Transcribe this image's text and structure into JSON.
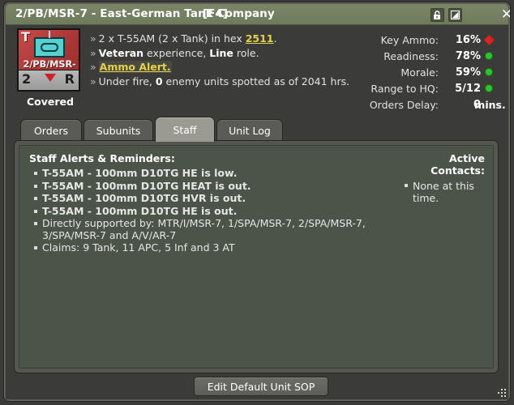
{
  "window": {
    "title": "2/PB/MSR-7 - East-German Tank Company",
    "hotkey": "[F4]",
    "buttons": {
      "lock": "lock-icon",
      "resize": "resize-icon",
      "close": "✕"
    }
  },
  "counter": {
    "type_letter": "T",
    "unit_id": "2/PB/MSR-",
    "left_digit": "2",
    "right_letter": "R",
    "status_label": "Covered",
    "symbol": "tank-symbol"
  },
  "info": {
    "line1_pre": "2 x T-55AM (2 x Tank) in hex ",
    "line1_hex": "2511",
    "line1_post": ".",
    "line2_a": "Veteran",
    "line2_b": " experience, ",
    "line2_c": "Line",
    "line2_d": " role.",
    "line3_link": "Ammo Alert.",
    "line4_a": "Under fire, ",
    "line4_b": "0",
    "line4_c": " enemy units spotted as of 2041 hrs.",
    "chevron": "»"
  },
  "status": [
    {
      "label": "Key Ammo:",
      "value": "16%",
      "indicator": "diamond",
      "color": "#e02020",
      "units": ""
    },
    {
      "label": "Readiness:",
      "value": "78%",
      "indicator": "dot",
      "color": "#2fc22f",
      "units": ""
    },
    {
      "label": "Morale:",
      "value": "59%",
      "indicator": "dot",
      "color": "#2fc22f",
      "units": ""
    },
    {
      "label": "Range to HQ:",
      "value": "5/12",
      "indicator": "dot",
      "color": "#2fc22f",
      "units": ""
    },
    {
      "label": "Orders Delay:",
      "value": "0",
      "indicator": "none",
      "color": "",
      "units": "mins."
    }
  ],
  "tabs": [
    {
      "label": "Orders",
      "active": false
    },
    {
      "label": "Subunits",
      "active": false
    },
    {
      "label": "Staff",
      "active": true
    },
    {
      "label": "Unit Log",
      "active": false
    }
  ],
  "staff": {
    "heading": "Staff Alerts & Reminders:",
    "items": [
      {
        "text": "T-55AM - 100mm D10TG HE is low.",
        "alert": true
      },
      {
        "text": "T-55AM - 100mm D10TG HEAT is out.",
        "alert": true
      },
      {
        "text": "T-55AM - 100mm D10TG HVR is out.",
        "alert": true
      },
      {
        "text": "T-55AM - 100mm D10TG HE is out.",
        "alert": true
      },
      {
        "text": "Directly supported by: MTR/I/MSR-7, 1/SPA/MSR-7, 2/SPA/MSR-7, 3/SPA/MSR-7 and A/V/AR-7",
        "alert": false
      },
      {
        "text": "Claims: 9 Tank, 11 APC, 5 Inf and 3 AT",
        "alert": false
      }
    ]
  },
  "contacts": {
    "heading": "Active Contacts:",
    "items": [
      {
        "text": "None at this time."
      }
    ]
  },
  "footer": {
    "edit_sop_label": "Edit Default Unit SOP"
  },
  "colors": {
    "titlebar": "#7b8667",
    "window_bg": "#3b3b39",
    "panel_bg": "#4c544a",
    "alert_yellow": "#f2e313",
    "link_yellow": "#e4d14a",
    "ok_green": "#2fc22f",
    "bad_red": "#e02020",
    "counter_red": "#b33c3c",
    "counter_cyan": "#56d0d0"
  }
}
